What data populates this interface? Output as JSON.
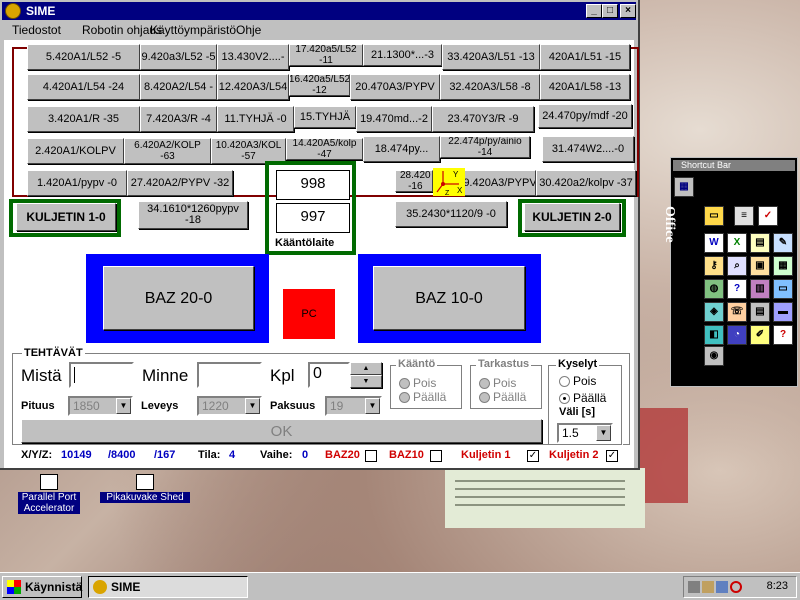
{
  "window": {
    "title": "SIME"
  },
  "menu": [
    "Tiedostot",
    "Robotin ohjaus",
    "Käyttöympäristö",
    "Ohje"
  ],
  "slots": [
    "5.420A1/L52 -5",
    "9.420a3/L52 -5",
    "13.430V2....-",
    "17.420a5/L52\n-11",
    "21.1300*...-3",
    "33.420A3/L51 -13",
    "420A1/L51 -15",
    "4.420A1/L54 -24",
    "8.420A2/L54 -",
    "12.420A3/L54",
    "16.420a5/L52\n-12",
    "20.470A3/PYPV",
    "32.420A3/L58 -8",
    "420A1/L58 -13",
    "3.420A1/R -35",
    "7.420A3/R -4",
    "11.TYHJÄ -0",
    "15.TYHJÄ",
    "19.470md...-2",
    "23.470Y3/R -9",
    "24.470py/mdf -20",
    "2.420A1/KOLPV",
    "6.420A2/KOLP\n-63",
    "10.420A3/KOL\n-57",
    "14.420A5/kolp\n-47",
    "18.474py...",
    "22.474p/py/ainio\n-14",
    "31.474W2....-0",
    "1.420A1/pypv -0",
    "27.420A2/PYPV -32",
    "28.420\n-16",
    "9.420A3/PYPV",
    "30.420a2/kolpv -37"
  ],
  "conveyor": {
    "left": "KULJETIN 1-0",
    "right": "KULJETIN 2-0",
    "left_slot": "34.1610*1260pypv\n-18",
    "right_slot": "35.2430*1120/9 -0"
  },
  "turntable": {
    "top": "998",
    "bottom": "997",
    "label": "Kääntölaite"
  },
  "baz": {
    "left": "BAZ 20-0",
    "right": "BAZ 10-0",
    "pc": "PC"
  },
  "tasks": {
    "title": "TEHTÄVÄT",
    "from_label": "Mistä",
    "to_label": "Minne",
    "qty_label": "Kpl",
    "qty_value": "0",
    "length_label": "Pituus",
    "length_value": "1850",
    "width_label": "Leveys",
    "width_value": "1220",
    "thick_label": "Paksuus",
    "thick_value": "19",
    "ok_label": "OK",
    "turn_title": "Kääntö",
    "check_title": "Tarkastus",
    "query_title": "Kyselyt",
    "off": "Pois",
    "on": "Päällä",
    "interval_label": "Väli [s]",
    "interval_value": "1.5"
  },
  "status": {
    "xyz_label": "X/Y/Z:",
    "x": "10149",
    "y": "/8400",
    "z": "/167",
    "state_label": "Tila:",
    "state_value": "4",
    "phase_label": "Vaihe:",
    "phase_value": "0",
    "baz20": "BAZ20",
    "baz10": "BAZ10",
    "conv1": "Kuljetin 1",
    "conv2": "Kuljetin 2",
    "check_mark": "✓"
  },
  "shortcut_bar": {
    "title": "Shortcut Bar",
    "label": "Office"
  },
  "desktop_icons": [
    "Parallel Port\nAccelerator",
    "Pikakuvake Shed"
  ],
  "taskbar": {
    "start": "Käynnistä",
    "task": "SIME",
    "clock": "8:23"
  },
  "colors": {
    "titlebar": "#000080",
    "green": "#006a00",
    "blue": "#0000ff",
    "red": "#ff0000",
    "maroon": "#800000"
  }
}
